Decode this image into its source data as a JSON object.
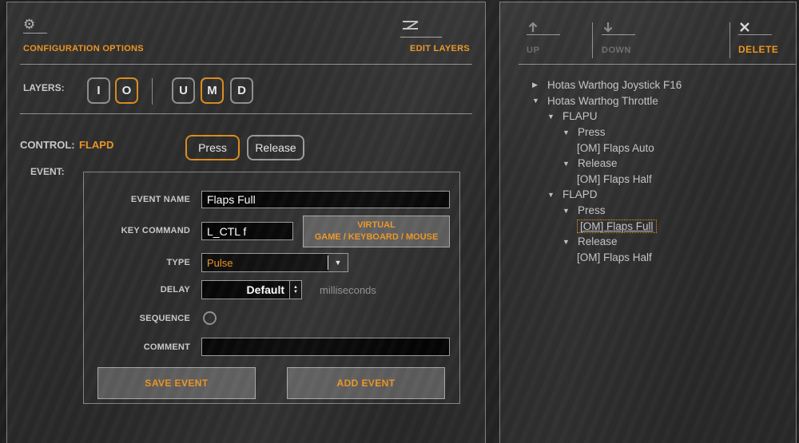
{
  "colors": {
    "accent": "#ef9421",
    "panel_border": "#7e7e7e",
    "input_bg": "#040404"
  },
  "header": {
    "config_label": "CONFIGURATION OPTIONS",
    "edit_layers_label": "EDIT LAYERS"
  },
  "layers": {
    "label": "LAYERS:",
    "buttons": [
      {
        "label": "I",
        "active": false
      },
      {
        "label": "O",
        "active": true
      },
      {
        "label": "U",
        "active": false
      },
      {
        "label": "M",
        "active": true
      },
      {
        "label": "D",
        "active": false
      }
    ]
  },
  "control": {
    "label": "CONTROL:",
    "value": "FLAPD",
    "press_label": "Press",
    "release_label": "Release",
    "active_button": "Press"
  },
  "event": {
    "panel_label": "EVENT:",
    "name_label": "EVENT NAME",
    "name_value": "Flaps Full",
    "key_label": "KEY COMMAND",
    "key_value": "L_CTL f",
    "virtual_line1": "VIRTUAL",
    "virtual_line2": "GAME / KEYBOARD / MOUSE",
    "type_label": "TYPE",
    "type_value": "Pulse",
    "delay_label": "DELAY",
    "delay_value": "Default",
    "delay_units": "milliseconds",
    "sequence_label": "SEQUENCE",
    "sequence_checked": false,
    "comment_label": "COMMENT",
    "comment_value": "",
    "save_label": "SAVE EVENT",
    "add_label": "ADD EVENT"
  },
  "toolbar": {
    "up_label": "UP",
    "down_label": "DOWN",
    "delete_label": "DELETE",
    "up_enabled": false,
    "down_enabled": false,
    "delete_enabled": true
  },
  "tree": {
    "items": [
      {
        "label": "Hotas Warthog Joystick F16",
        "level": 0,
        "state": "collapsed",
        "selected": false
      },
      {
        "label": "Hotas Warthog Throttle",
        "level": 0,
        "state": "expanded",
        "selected": false
      },
      {
        "label": "FLAPU",
        "level": 1,
        "state": "expanded",
        "selected": false
      },
      {
        "label": "Press",
        "level": 2,
        "state": "expanded",
        "selected": false
      },
      {
        "label": "[OM] Flaps Auto",
        "level": 3,
        "state": "leaf",
        "selected": false
      },
      {
        "label": "Release",
        "level": 2,
        "state": "expanded",
        "selected": false
      },
      {
        "label": "[OM] Flaps Half",
        "level": 3,
        "state": "leaf",
        "selected": false
      },
      {
        "label": "FLAPD",
        "level": 1,
        "state": "expanded",
        "selected": false
      },
      {
        "label": "Press",
        "level": 2,
        "state": "expanded",
        "selected": false
      },
      {
        "label": "[OM] Flaps Full",
        "level": 3,
        "state": "leaf",
        "selected": true
      },
      {
        "label": "Release",
        "level": 2,
        "state": "expanded",
        "selected": false
      },
      {
        "label": "[OM] Flaps Half",
        "level": 3,
        "state": "leaf",
        "selected": false
      }
    ]
  }
}
